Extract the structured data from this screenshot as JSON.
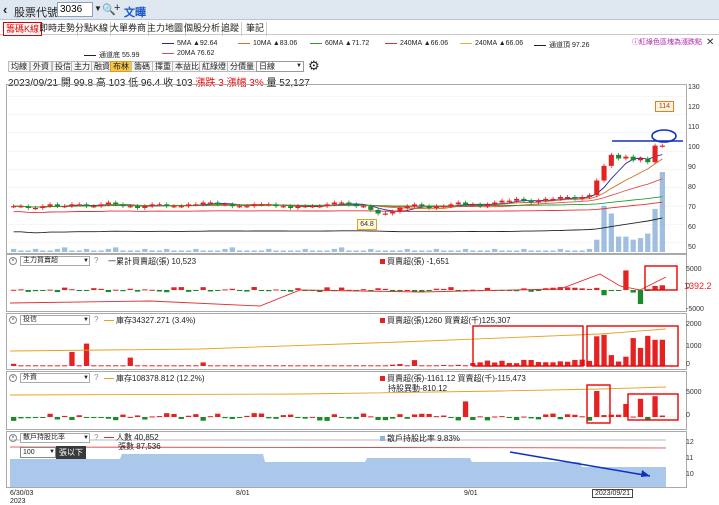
{
  "topbar": {
    "stock_code_label": "股票代號",
    "stock_code_value": "3036",
    "wenzhang": "文曄"
  },
  "tabs": [
    "籌碼K線",
    "即時走勢",
    "分點K線",
    "大單券商",
    "主力地圖",
    "個股分析",
    "追蹤",
    "筆記"
  ],
  "active_tab": 0,
  "tip_link": "紅綠色區塊為漲跌點",
  "legend": {
    "ma5": "5MA ▲92.64",
    "ma10": "10MA ▲83.06",
    "ma60": "60MA ▲71.72",
    "ma240": "240MA ▲66.06",
    "ma240b": "240MA ▲66.06",
    "channel_top": "通道頂 97.26",
    "channel_bottom": "通道底 55.99",
    "ma20": "20MA 76.62"
  },
  "colors": {
    "up": "#e52222",
    "down": "#1a8a2a",
    "volume": "#8fb3d9",
    "ma5": "#2222aa",
    "ma10": "#d07020",
    "ma60": "#2a9a2a",
    "ma240": "#e03030",
    "ma240b": "#e8b040",
    "ma20": "#e05050"
  },
  "toolbar": [
    "均線",
    "外資",
    "投信",
    "主力",
    "融資",
    "布林",
    "籌碼",
    "擇重",
    "本益比",
    "紅綠燈",
    "分價量"
  ],
  "toolbar_active": [
    5
  ],
  "period_select": "日線",
  "info": {
    "date_ohlc": "2023/09/21 開 99.8 高 103 低 96.4 收 103",
    "change": "漲跌 3 漲幅 3%",
    "volume": "量 52,127"
  },
  "main_axis": [
    "130",
    "120",
    "110",
    "100",
    "90",
    "80",
    "70",
    "60",
    "50"
  ],
  "price_labels": {
    "high": "114",
    "low": "64.8"
  },
  "panes": [
    {
      "name": "主力買賣超",
      "left_label": "一累計買賣超(張) 10,523",
      "right_label": "買賣超(張) -1,651",
      "axis": [
        "5000",
        "0",
        "-5000"
      ],
      "current_value": "1392.2"
    },
    {
      "name": "投信",
      "left_label": "庫存34327.271 (3.4%)",
      "right_label": "買賣超(張)1260 買賣超(千)125,307",
      "axis": [
        "2000",
        "1000",
        "0"
      ]
    },
    {
      "name": "外資",
      "left_label": "庫存108378.812 (12.2%)",
      "right_label": "買賣超(張)-1161.12 買賣超(千)-115,473",
      "right_label2": "持股異動-810.12",
      "axis": [
        "5000",
        "0"
      ]
    },
    {
      "name": "散戶持股比率",
      "left_label": "人數 40,852",
      "left_label2": "張數 87,536",
      "right_label": "散戶持股比率 9.83%",
      "axis": [
        "12",
        "11",
        "10"
      ]
    }
  ],
  "rank_select": "100",
  "rank_label": "張以下",
  "dates": {
    "d1": "6/30/03",
    "d1b": "2023",
    "d2": "8/01",
    "d3": "9/01",
    "cursor": "2023/09/21"
  },
  "chart_data": {
    "type": "candlestick",
    "ylim": [
      45,
      135
    ],
    "closes": [
      70,
      70,
      69,
      69,
      70,
      71,
      70,
      70,
      71,
      71,
      70,
      70,
      71,
      72,
      71,
      70,
      70,
      69,
      70,
      71,
      71,
      70,
      70,
      70,
      71,
      71,
      72,
      72,
      71,
      71,
      70,
      70,
      70,
      71,
      71,
      71,
      70,
      70,
      69,
      70,
      70,
      70,
      70,
      71,
      72,
      72,
      71,
      70,
      70,
      68,
      66,
      66,
      67,
      69,
      70,
      71,
      70,
      69,
      70,
      70,
      71,
      72,
      71,
      71,
      70,
      71,
      72,
      73,
      73,
      74,
      73,
      72,
      73,
      74,
      74,
      75,
      75,
      74,
      75,
      76,
      84,
      92,
      98,
      96,
      97,
      95,
      96,
      94,
      103,
      103
    ],
    "volumes": [
      2,
      1,
      1,
      2,
      1,
      1,
      2,
      3,
      1,
      1,
      2,
      1,
      1,
      2,
      3,
      1,
      1,
      1,
      2,
      1,
      1,
      2,
      1,
      1,
      1,
      2,
      1,
      1,
      1,
      2,
      3,
      1,
      1,
      1,
      1,
      2,
      1,
      1,
      1,
      1,
      2,
      1,
      1,
      1,
      2,
      3,
      1,
      1,
      1,
      2,
      1,
      1,
      1,
      1,
      2,
      1,
      1,
      1,
      2,
      1,
      1,
      1,
      2,
      1,
      1,
      1,
      2,
      1,
      1,
      1,
      2,
      1,
      1,
      1,
      1,
      2,
      1,
      1,
      1,
      2,
      8,
      30,
      25,
      10,
      10,
      8,
      9,
      12,
      28,
      52
    ]
  }
}
